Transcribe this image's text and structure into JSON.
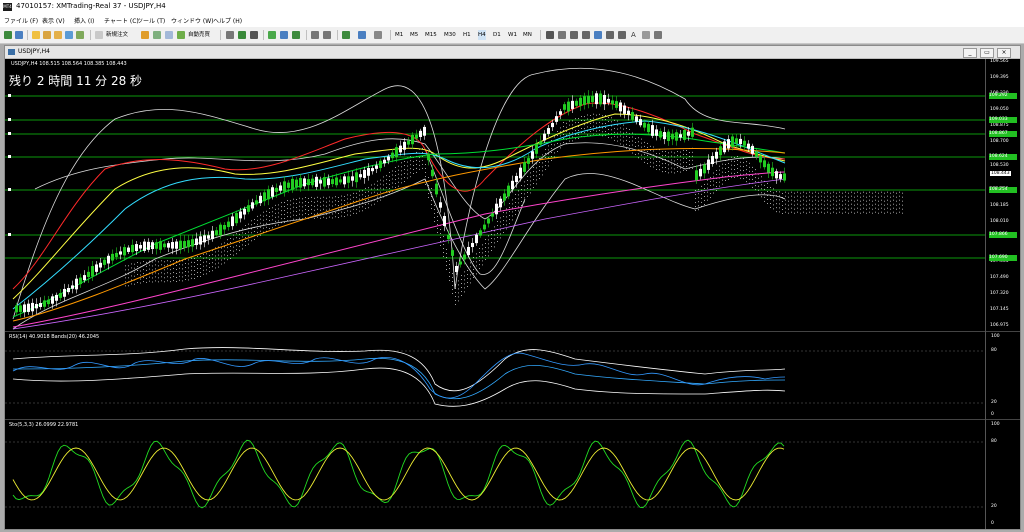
{
  "window": {
    "title": "47010157: XMTrading-Real 37 - USDJPY,H4",
    "icon": "app-icon"
  },
  "menu": [
    "ファイル (F)",
    "表示 (V)",
    "挿入 (I)",
    "チャート (C)",
    "ツール (T)",
    "ウィンドウ (W)",
    "ヘルプ (H)"
  ],
  "toolbar": {
    "new_order": "新規注文",
    "auto_trading": "自動売買",
    "timeframes": [
      "M1",
      "M5",
      "M15",
      "M30",
      "H1",
      "H4",
      "D1",
      "W1",
      "MN"
    ],
    "text_tool": "A"
  },
  "child": {
    "title": "USDJPY,H4",
    "buttons": [
      "minimize-icon",
      "restore-icon",
      "close-icon"
    ]
  },
  "chart": {
    "symbol_info": "USDJPY,H4  108.515 108.564 108.385 108.443",
    "countdown": "残り 2 時間 11 分 28 秒",
    "price_labels": [
      "109.565",
      "109.395",
      "109.220",
      "109.050",
      "108.875",
      "108.700",
      "108.530",
      "108.443",
      "108.360",
      "108.185",
      "108.010",
      "107.835",
      "107.665",
      "107.490",
      "107.320",
      "107.145",
      "106.975"
    ],
    "line_tags": [
      "109.292",
      "109.033",
      "108.867",
      "108.624",
      "108.254",
      "107.866",
      "107.690"
    ],
    "current_price": "108.443",
    "rsi_title": "RSI(14) 40.9018  Bands(20) 46.2045",
    "rsi_levels": [
      "100",
      "80",
      "20",
      "0"
    ],
    "sto_title": "Sto(5,3,3) 26.0999 22.9781",
    "sto_levels": [
      "100",
      "80",
      "20",
      "0"
    ]
  },
  "colors": {
    "bg": "#000000",
    "up_candle": "#22cc22",
    "down_candle": "#ffffff",
    "ma_red": "#ff2a2a",
    "ma_yellow": "#ffff44",
    "ma_cyan": "#33ddff",
    "ma_green": "#00dd33",
    "ma_orange": "#ff9900",
    "ma_magenta": "#ff44cc",
    "hline": "#11cc11"
  }
}
